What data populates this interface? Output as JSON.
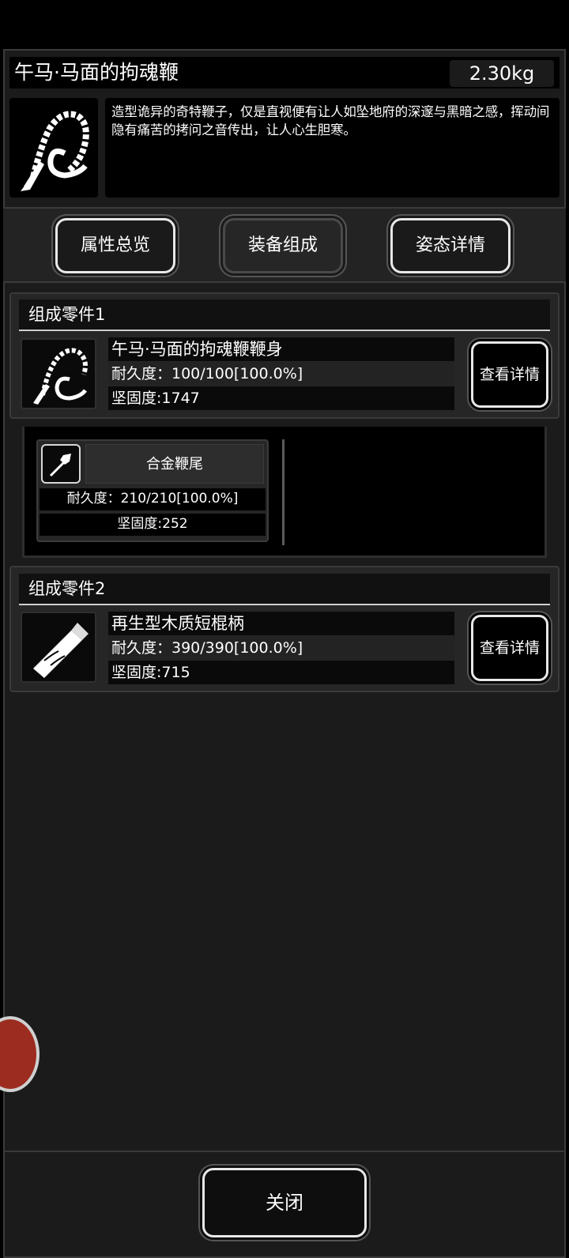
{
  "item": {
    "name": "午马·马面的拘魂鞭",
    "weight": "2.30kg",
    "icon": "whip-icon",
    "description": "造型诡异的奇特鞭子，仅是直视便有让人如坠地府的深邃与黑暗之感，挥动间隐有痛苦的拷问之音传出，让人心生胆寒。"
  },
  "tabs": [
    {
      "label": "属性总览",
      "active": false
    },
    {
      "label": "装备组成",
      "active": true
    },
    {
      "label": "姿态详情",
      "active": false
    }
  ],
  "parts": [
    {
      "header": "组成零件1",
      "name": "午马·马面的拘魂鞭鞭身",
      "durability": "耐久度：100/100[100.0%]",
      "hardness": "坚固度:1747",
      "button": "查看详情",
      "icon": "whip-body-icon"
    },
    {
      "header": "组成零件2",
      "name": "再生型木质短棍柄",
      "durability": "耐久度：390/390[100.0%]",
      "hardness": "坚固度:715",
      "button": "查看详情",
      "icon": "wooden-handle-icon"
    }
  ],
  "subpart": {
    "name": "合金鞭尾",
    "durability": "耐久度：210/210[100.0%]",
    "hardness": "坚固度:252",
    "icon": "whip-tail-icon"
  },
  "close_label": "关闭",
  "colors": {
    "panel": "#1b1b1b",
    "border": "#e8e8e8",
    "float_icon": "#9c2c1f"
  }
}
